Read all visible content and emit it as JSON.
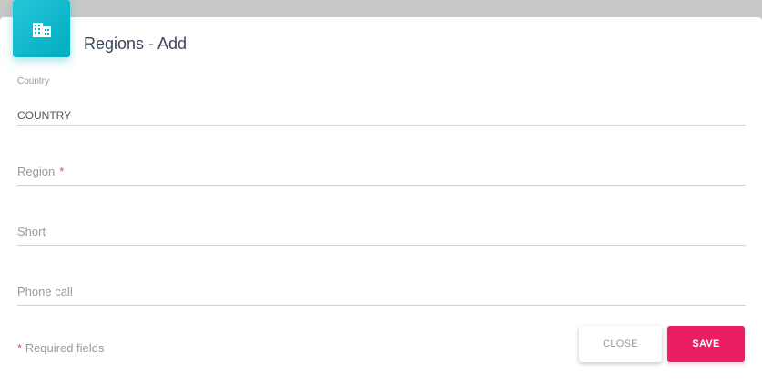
{
  "header": {
    "icon": "building-icon",
    "title": "Regions - Add",
    "accent_color": "#00acc1"
  },
  "form": {
    "country": {
      "label": "Country",
      "value": "COUNTRY"
    },
    "region": {
      "placeholder": "Region",
      "required_marker": "*"
    },
    "short": {
      "placeholder": "Short"
    },
    "phone_call": {
      "placeholder": "Phone call"
    }
  },
  "footer": {
    "required_marker": "*",
    "required_note": "Required fields",
    "close_label": "CLOSE",
    "save_label": "SAVE",
    "save_color": "#e91e63"
  }
}
